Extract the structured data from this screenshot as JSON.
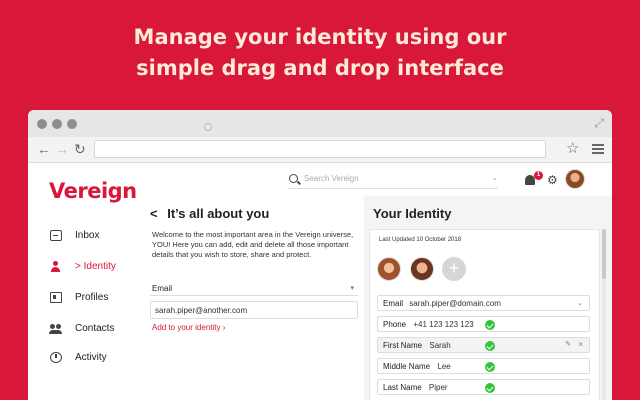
{
  "headline": {
    "line1": "Manage your identity using our",
    "line2": "simple drag and drop interface"
  },
  "browser": {
    "nav_back": "←",
    "nav_forward": "→",
    "nav_reload": "↻",
    "star": "☆",
    "resize": "⤢"
  },
  "app": {
    "logo": "Vereign",
    "search_placeholder": "Search Vereign",
    "notification_count": "1",
    "gear": "⚙"
  },
  "sidebar": {
    "items": [
      {
        "label": "Inbox"
      },
      {
        "label": "> Identity"
      },
      {
        "label": "Profiles"
      },
      {
        "label": "Contacts"
      },
      {
        "label": "Activity"
      }
    ]
  },
  "identity_page": {
    "back": "<",
    "title": "It’s all about you",
    "welcome": "Welcome to the most important area in the Vereign universe, YOU! Here you can add, edit and delete all those important details that you wish to store, share and protect.",
    "field_type": "Email",
    "field_value": "sarah.piper@another.com",
    "add_link": "Add to your identity ›"
  },
  "your_identity": {
    "title": "Your Identity",
    "last_updated": "Last Updated 10 October 2018",
    "add_picture": "+",
    "email_label": "Email",
    "email_value": "sarah.piper@domain.com",
    "fields": [
      {
        "label": "Phone",
        "value": "+41 123 123 123"
      },
      {
        "label": "First Name",
        "value": "Sarah"
      },
      {
        "label": "Middle Name",
        "value": "Lee"
      },
      {
        "label": "Last Name",
        "value": "Piper"
      }
    ],
    "edit_icon": "✎",
    "close_icon": "×"
  },
  "colors": {
    "brand": "#d8173a",
    "verified": "#36c33a",
    "headline_text": "#fdebd6"
  }
}
